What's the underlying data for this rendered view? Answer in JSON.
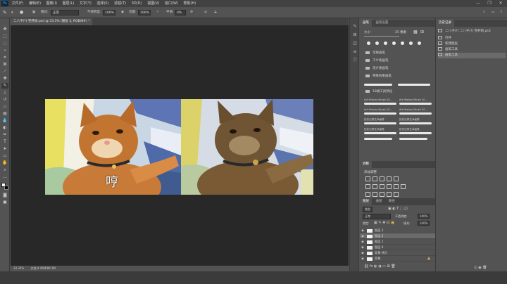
{
  "menubar": {
    "logo": "Ps",
    "items": [
      "文件(F)",
      "编辑(E)",
      "图像(I)",
      "图层(L)",
      "文字(Y)",
      "选择(S)",
      "滤镜(T)",
      "3D(D)",
      "视图(V)",
      "窗口(W)",
      "帮助(H)"
    ],
    "window_controls": [
      "—",
      "❐",
      "✕"
    ]
  },
  "options": {
    "mode_label": "模式:",
    "mode_value": "正常",
    "opacity_label": "不透明度:",
    "opacity_value": "100%",
    "flow_label": "流量:",
    "flow_value": "100%",
    "smooth_label": "平滑:",
    "smooth_value": "0%"
  },
  "document": {
    "tab_title": "二八子(?)-完开始.psd @ 33.3% (图层 3, RGB/8#) *",
    "caption": "哼"
  },
  "status": {
    "zoom": "33.33%",
    "doc_info": "文档:4.46M/89.3M"
  },
  "brush_panel": {
    "tabs": [
      "画笔",
      "画笔设置"
    ],
    "size_label": "大小:",
    "size_value": "25 像素",
    "folders": [
      "常规画笔",
      "干介质画笔",
      "湿介质画笔",
      "特殊效果画笔"
    ],
    "group_name": "18幅工具预设",
    "presets": [
      "Art History Brush 20...",
      "Art History Brush 20...",
      "Art History Brush 20...",
      "Art History Brush 20...",
      "历史记录艺术画笔",
      "历史记录艺术画笔",
      "历史记录艺术画笔",
      "历史记录艺术画笔"
    ]
  },
  "adjustments_panel": {
    "tab": "调整",
    "title": "添加调整"
  },
  "layers_panel": {
    "tabs": [
      "图层",
      "通道",
      "路径"
    ],
    "kind_label": "类型",
    "blend_mode": "正常",
    "opacity_label": "不透明度:",
    "opacity_value": "100%",
    "lock_label": "锁定:",
    "fill_label": "填充:",
    "fill_value": "100%",
    "layers": [
      {
        "name": "图层 3",
        "selected": false
      },
      {
        "name": "图层 2",
        "selected": true
      },
      {
        "name": "图层 1",
        "selected": false
      },
      {
        "name": "图层 4",
        "selected": false
      },
      {
        "name": "背景 拷贝",
        "selected": false
      },
      {
        "name": "背景",
        "selected": false
      }
    ],
    "bottom_layer": "背景"
  },
  "history_panel": {
    "tab": "历史记录",
    "snapshot": "二八子(?) 二八子(?) 完开始.psd",
    "items": [
      {
        "label": "打开",
        "selected": false
      },
      {
        "label": "新建图层",
        "selected": false
      },
      {
        "label": "画笔工具",
        "selected": false
      },
      {
        "label": "画笔工具",
        "selected": true
      }
    ]
  },
  "colors": {
    "app_bg": "#535353",
    "canvas_bg": "#282828",
    "menubar_bg": "#424242"
  }
}
